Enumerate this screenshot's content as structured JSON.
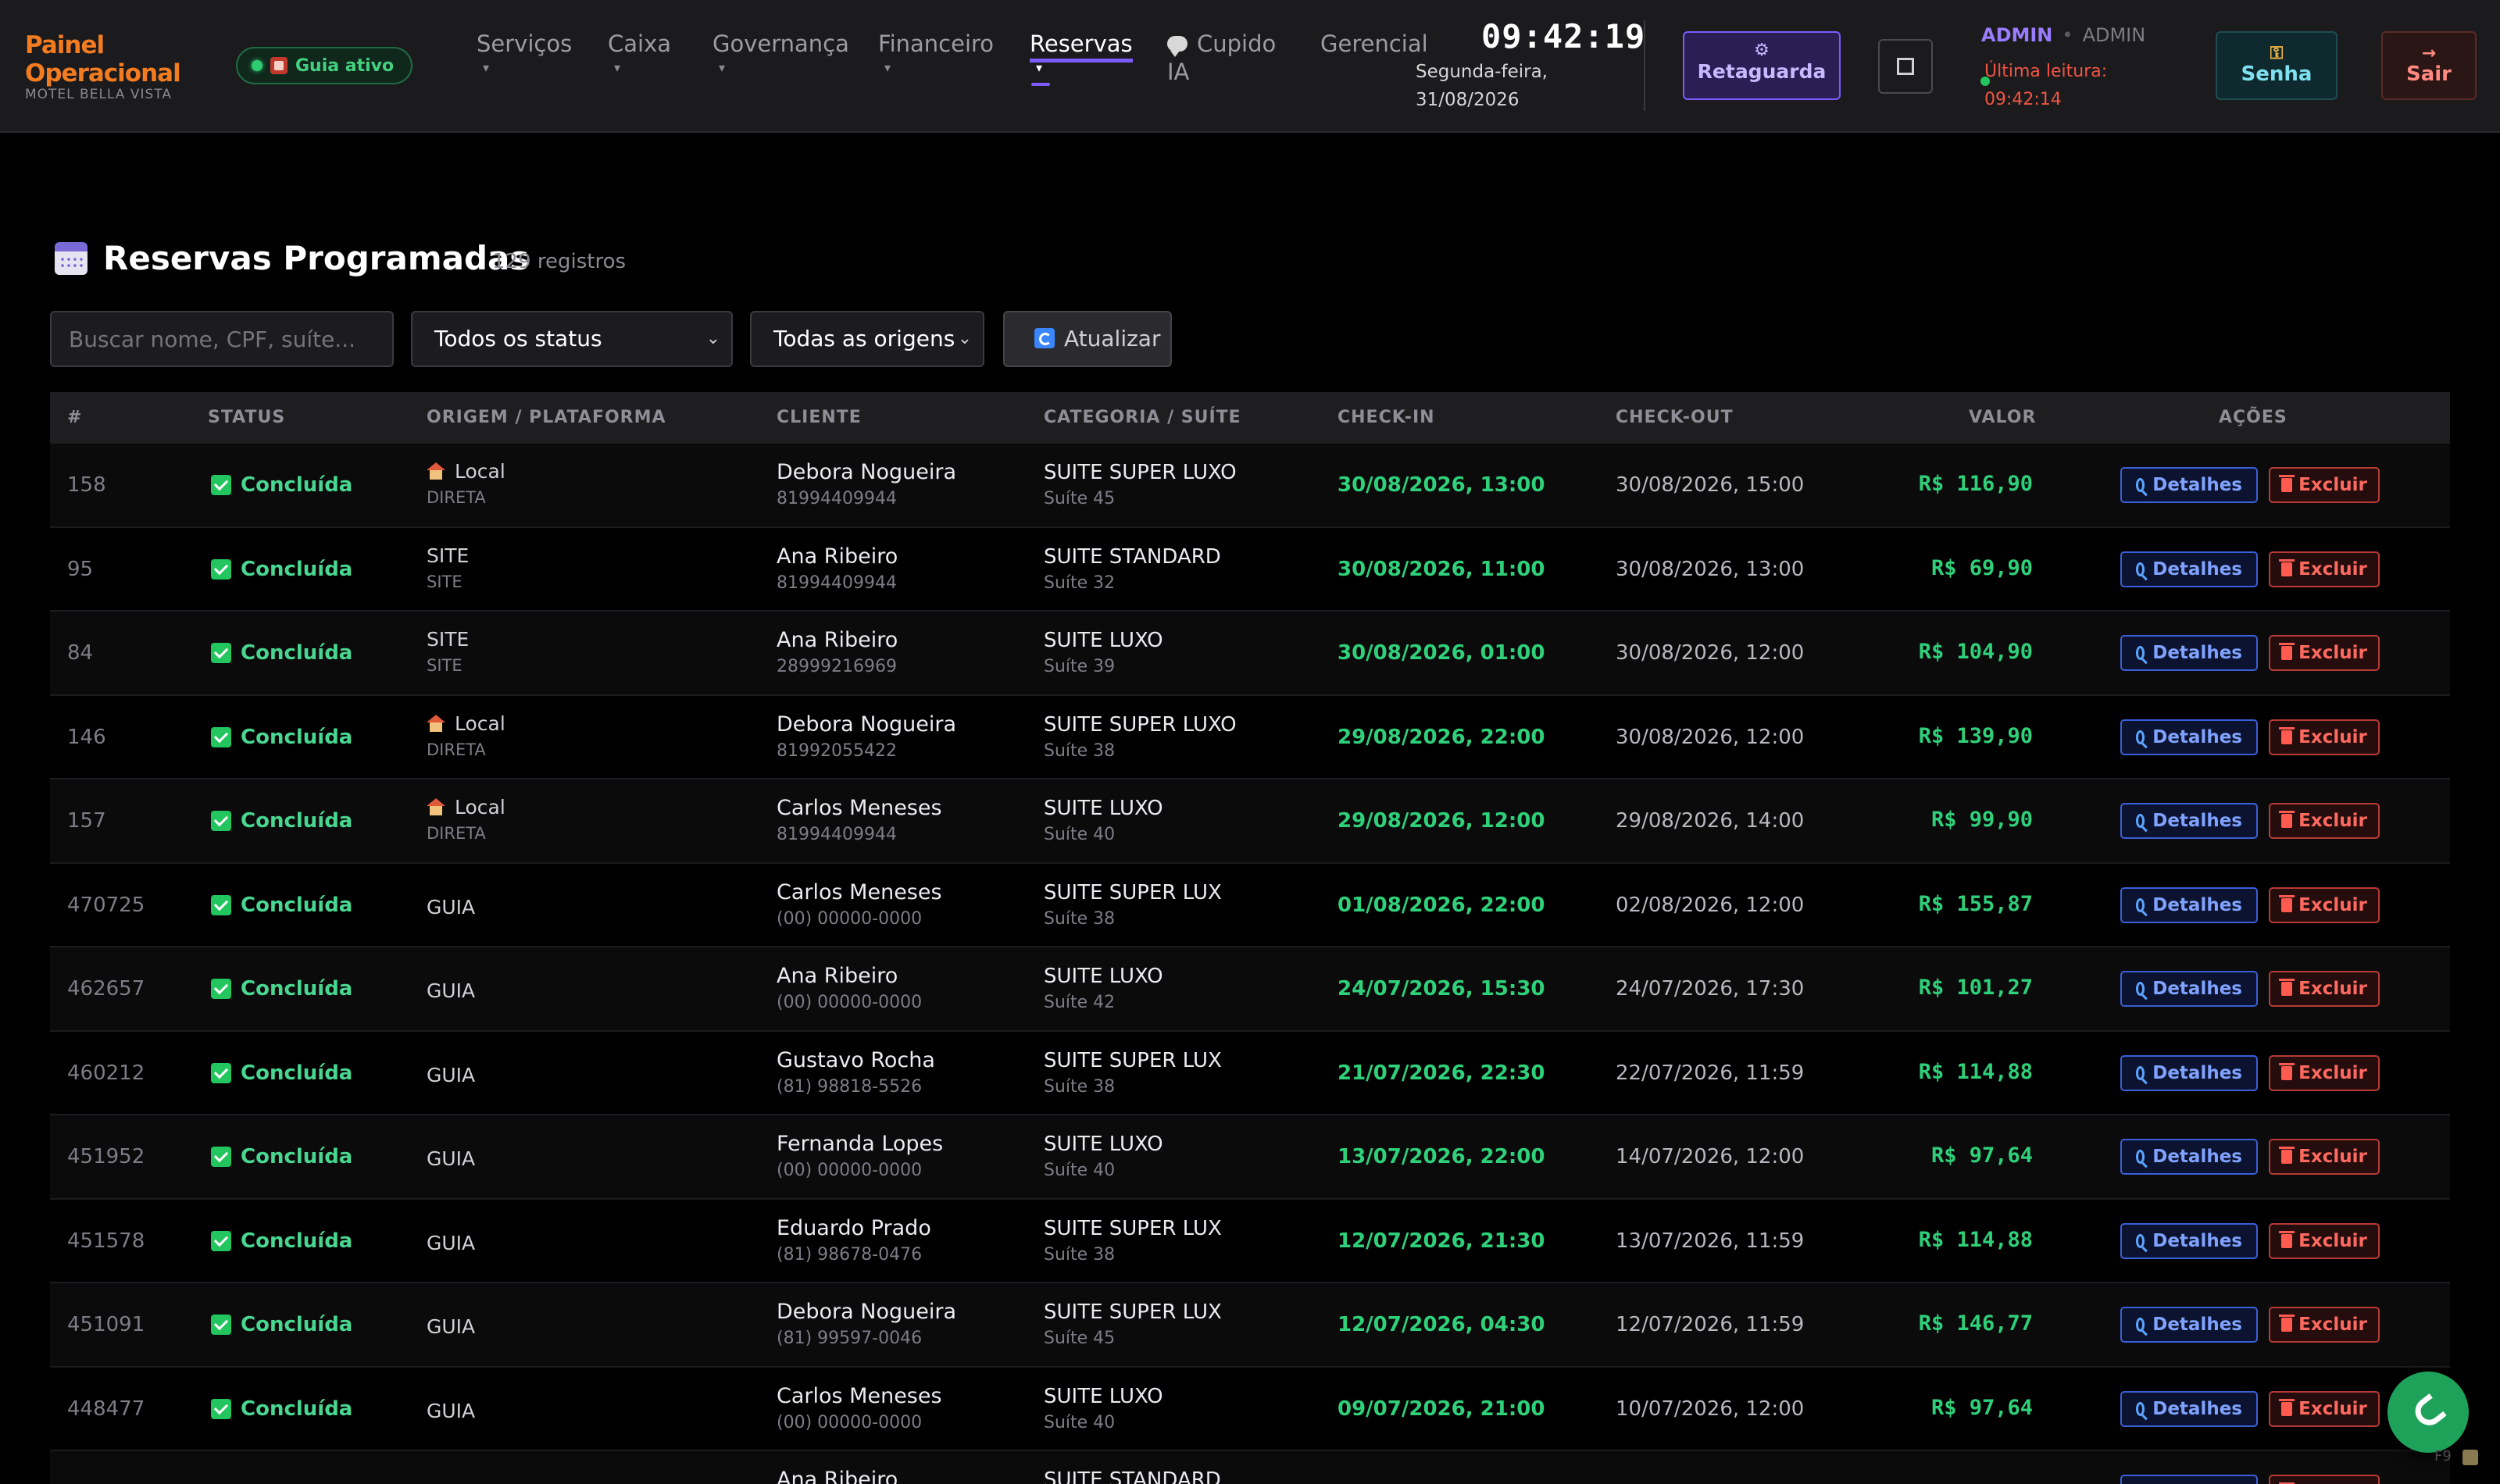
{
  "brand": {
    "line1": "Painel",
    "line2": "Operacional",
    "sub": "MOTEL BELLA VISTA"
  },
  "guia_pill": "Guia ativo",
  "nav": [
    {
      "label": "Serviços",
      "caret": "▾"
    },
    {
      "label": "Caixa",
      "caret": "▾"
    },
    {
      "label": "Governança",
      "caret": "▾"
    },
    {
      "label": "Financeiro",
      "caret": "▾"
    },
    {
      "label": "Reservas",
      "caret": "▾",
      "active": true
    },
    {
      "label": "Cupido",
      "label2": "IA"
    },
    {
      "label": "Gerencial"
    }
  ],
  "clock": {
    "time": "09:42:19",
    "date_line1": "Segunda-feira,",
    "date_line2": "31/08/2026"
  },
  "header_buttons": {
    "retaguarda": "Retaguarda",
    "senha": "Senha",
    "sair": "Sair"
  },
  "user": {
    "role1": "ADMIN",
    "sep": "•",
    "role2": "ADMIN",
    "last_read": "Última leitura:",
    "last_read_time": "09:42:14"
  },
  "page": {
    "title": "Reservas Programadas",
    "count": "129 registros"
  },
  "filters": {
    "search_placeholder": "Buscar nome, CPF, suíte...",
    "status_selected": "Todos os status",
    "origin_selected": "Todas as origens",
    "refresh_label": "Atualizar"
  },
  "table": {
    "headers": [
      "#",
      "STATUS",
      "ORIGEM / PLATAFORMA",
      "CLIENTE",
      "CATEGORIA / SUÍTE",
      "CHECK-IN",
      "CHECK-OUT",
      "VALOR",
      "AÇÕES"
    ],
    "details_label": "Detalhes",
    "delete_label": "Excluir",
    "rows": [
      {
        "id": "158",
        "status": "Concluída",
        "origin": "Local",
        "origin_sub": "DIRETA",
        "origin_icon": "house-icon",
        "client": "Debora Nogueira",
        "phone": "81994409944",
        "category": "SUITE SUPER LUXO",
        "suite": "Suíte 45",
        "checkin": "30/08/2026, 13:00",
        "checkout": "30/08/2026, 15:00",
        "value": "R$ 116,90"
      },
      {
        "id": "95",
        "status": "Concluída",
        "origin": "SITE",
        "origin_sub": "SITE",
        "client": "Ana Ribeiro",
        "phone": "81994409944",
        "category": "SUITE STANDARD",
        "suite": "Suíte 32",
        "checkin": "30/08/2026, 11:00",
        "checkout": "30/08/2026, 13:00",
        "value": "R$ 69,90"
      },
      {
        "id": "84",
        "status": "Concluída",
        "origin": "SITE",
        "origin_sub": "SITE",
        "client": "Ana Ribeiro",
        "phone": "28999216969",
        "category": "SUITE LUXO",
        "suite": "Suíte 39",
        "checkin": "30/08/2026, 01:00",
        "checkout": "30/08/2026, 12:00",
        "value": "R$ 104,90"
      },
      {
        "id": "146",
        "status": "Concluída",
        "origin": "Local",
        "origin_sub": "DIRETA",
        "origin_icon": "house-icon",
        "client": "Debora Nogueira",
        "phone": "81992055422",
        "category": "SUITE SUPER LUXO",
        "suite": "Suíte 38",
        "checkin": "29/08/2026, 22:00",
        "checkout": "30/08/2026, 12:00",
        "value": "R$ 139,90"
      },
      {
        "id": "157",
        "status": "Concluída",
        "origin": "Local",
        "origin_sub": "DIRETA",
        "origin_icon": "house-icon",
        "client": "Carlos Meneses",
        "phone": "81994409944",
        "category": "SUITE LUXO",
        "suite": "Suíte 40",
        "checkin": "29/08/2026, 12:00",
        "checkout": "29/08/2026, 14:00",
        "value": "R$ 99,90"
      },
      {
        "id": "470725",
        "status": "Concluída",
        "origin": "GUIA",
        "client": "Carlos Meneses",
        "phone": "(00) 00000-0000",
        "category": "SUITE SUPER LUX",
        "suite": "Suíte 38",
        "checkin": "01/08/2026, 22:00",
        "checkout": "02/08/2026, 12:00",
        "value": "R$ 155,87"
      },
      {
        "id": "462657",
        "status": "Concluída",
        "origin": "GUIA",
        "client": "Ana Ribeiro",
        "phone": "(00) 00000-0000",
        "category": "SUITE LUXO",
        "suite": "Suíte 42",
        "checkin": "24/07/2026, 15:30",
        "checkout": "24/07/2026, 17:30",
        "value": "R$ 101,27"
      },
      {
        "id": "460212",
        "status": "Concluída",
        "origin": "GUIA",
        "client": "Gustavo Rocha",
        "phone": "(81) 98818-5526",
        "category": "SUITE SUPER LUX",
        "suite": "Suíte 38",
        "checkin": "21/07/2026, 22:30",
        "checkout": "22/07/2026, 11:59",
        "value": "R$ 114,88"
      },
      {
        "id": "451952",
        "status": "Concluída",
        "origin": "GUIA",
        "client": "Fernanda Lopes",
        "phone": "(00) 00000-0000",
        "category": "SUITE LUXO",
        "suite": "Suíte 40",
        "checkin": "13/07/2026, 22:00",
        "checkout": "14/07/2026, 12:00",
        "value": "R$ 97,64"
      },
      {
        "id": "451578",
        "status": "Concluída",
        "origin": "GUIA",
        "client": "Eduardo Prado",
        "phone": "(81) 98678-0476",
        "category": "SUITE SUPER LUX",
        "suite": "Suíte 38",
        "checkin": "12/07/2026, 21:30",
        "checkout": "13/07/2026, 11:59",
        "value": "R$ 114,88"
      },
      {
        "id": "451091",
        "status": "Concluída",
        "origin": "GUIA",
        "client": "Debora Nogueira",
        "phone": "(81) 99597-0046",
        "category": "SUITE SUPER LUX",
        "suite": "Suíte 45",
        "checkin": "12/07/2026, 04:30",
        "checkout": "12/07/2026, 11:59",
        "value": "R$ 146,77"
      },
      {
        "id": "448477",
        "status": "Concluída",
        "origin": "GUIA",
        "client": "Carlos Meneses",
        "phone": "(00) 00000-0000",
        "category": "SUITE LUXO",
        "suite": "Suíte 40",
        "checkin": "09/07/2026, 21:00",
        "checkout": "10/07/2026, 12:00",
        "value": "R$ 97,64"
      },
      {
        "id": "",
        "status": "",
        "origin": "",
        "client": "Ana Ribeiro",
        "phone": "",
        "category": "SUITE STANDARD",
        "suite": "",
        "checkin": "",
        "checkout": "",
        "value": ""
      }
    ]
  },
  "floating": {
    "shortcut": "F9"
  },
  "colors": {
    "accent": "#7c5cff",
    "brand": "#f47c20",
    "success": "#2fd07a",
    "danger": "#ff6a60",
    "info": "#7fa2ff"
  }
}
